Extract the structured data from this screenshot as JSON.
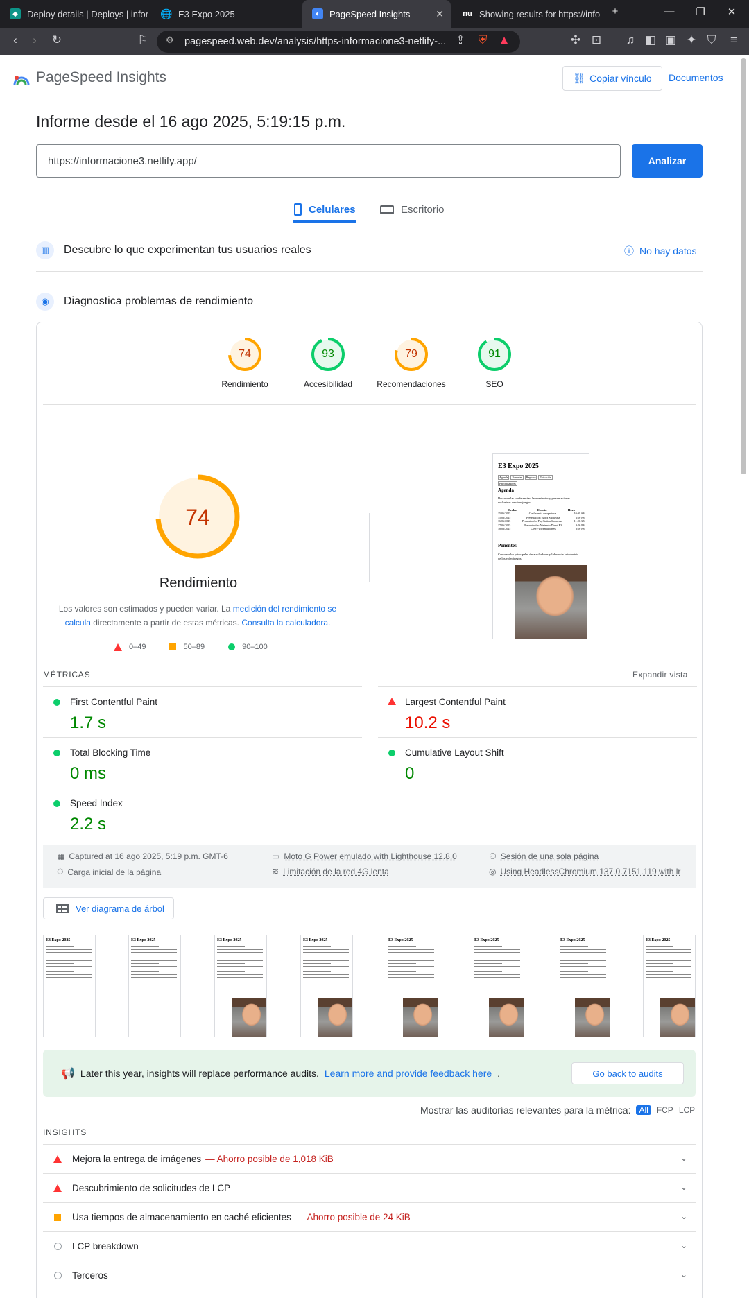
{
  "browser": {
    "tabs": [
      {
        "title": "Deploy details | Deploys | inform",
        "icon": "netlify-icon"
      },
      {
        "title": "E3 Expo 2025",
        "icon": "globe-icon"
      },
      {
        "title": "PageSpeed Insights",
        "icon": "pagespeed-icon"
      },
      {
        "title": "Showing results for https://infor",
        "icon": "search-icon"
      }
    ],
    "url": "pagespeed.web.dev/analysis/https-informacione3-netlify-...",
    "badge_count": "2"
  },
  "header": {
    "brand": "PageSpeed Insights",
    "copy_link": "Copiar vínculo",
    "docs": "Documentos"
  },
  "report": {
    "title": "Informe desde el 16 ago 2025, 5:19:15 p.m.",
    "url_value": "https://informacione3.netlify.app/",
    "analyze": "Analizar",
    "device_tabs": {
      "mobile": "Celulares",
      "desktop": "Escritorio"
    },
    "real_users": {
      "title": "Descubre lo que experimentan tus usuarios reales",
      "status": "No hay datos"
    },
    "diagnose": {
      "title": "Diagnostica problemas de rendimiento"
    }
  },
  "scores": [
    {
      "label": "Rendimiento",
      "value": 74,
      "color": "#ffa400"
    },
    {
      "label": "Accesibilidad",
      "value": 93,
      "color": "#0cce6b"
    },
    {
      "label": "Recomendaciones",
      "value": 79,
      "color": "#ffa400"
    },
    {
      "label": "SEO",
      "value": 91,
      "color": "#0cce6b"
    }
  ],
  "performance": {
    "score": 74,
    "label": "Rendimiento",
    "disclaimer_pre": "Los valores son estimados y pueden variar. La ",
    "disclaimer_link1": "medición del rendimiento se calcula",
    "disclaimer_mid": " directamente a partir de estas métricas. ",
    "disclaimer_link2": "Consulta la calculadora.",
    "legend": [
      "0–49",
      "50–89",
      "90–100"
    ]
  },
  "screenshot": {
    "title": "E3 Expo 2025",
    "nav": [
      "Agenda",
      "Ponentes",
      "Registro",
      "Ubicación",
      "Patrocinadores"
    ],
    "agenda_h": "Agenda",
    "agenda_p": "Descubre las conferencias, lanzamientos y presentaciones exclusivas de videojuegos.",
    "table_head": [
      "Fecha",
      "Evento",
      "Hora"
    ],
    "rows": [
      [
        "15/06/2025",
        "Conferencia de apertura",
        "10:00 AM"
      ],
      [
        "15/06/2025",
        "Presentación: Xbox Showcase",
        "1:00 PM"
      ],
      [
        "16/06/2025",
        "Presentación: PlayStation Showcase",
        "11:00 AM"
      ],
      [
        "17/06/2025",
        "Presentación: Nintendo Direct E3",
        "3:00 PM"
      ],
      [
        "18/06/2025",
        "Cierre y premiaciones",
        "6:00 PM"
      ]
    ],
    "speakers_h": "Ponentes",
    "speakers_p": "Conoce a los principales desarrolladores y líderes de la industria de los videojuegos."
  },
  "metrics": {
    "heading": "MÉTRICAS",
    "expand": "Expandir vista",
    "items": [
      {
        "name": "First Contentful Paint",
        "value": "1.7 s",
        "status": "good"
      },
      {
        "name": "Largest Contentful Paint",
        "value": "10.2 s",
        "status": "poor"
      },
      {
        "name": "Total Blocking Time",
        "value": "0 ms",
        "status": "good"
      },
      {
        "name": "Cumulative Layout Shift",
        "value": "0",
        "status": "good"
      },
      {
        "name": "Speed Index",
        "value": "2.2 s",
        "status": "good"
      }
    ]
  },
  "environment": {
    "captured": "Captured at 16 ago 2025, 5:19 p.m. GMT-6",
    "load": "Carga inicial de la página",
    "device": "Moto G Power emulado with Lighthouse 12.8.0",
    "network": "Limitación de la red 4G lenta",
    "session": "Sesión de una sola página",
    "browser": "Using HeadlessChromium 137.0.7151.119 with lr"
  },
  "tree_button": "Ver diagrama de árbol",
  "banner": {
    "text": "Later this year, insights will replace performance audits.",
    "link": "Learn more and provide feedback here",
    "button": "Go back to audits"
  },
  "audit_filter": {
    "label": "Mostrar las auditorías relevantes para la métrica:",
    "options": [
      "All",
      "FCP",
      "LCP"
    ]
  },
  "insights": {
    "heading": "INSIGHTS",
    "items": [
      {
        "title": "Mejora la entrega de imágenes",
        "saving": "— Ahorro posible de 1,018 KiB",
        "status": "poor"
      },
      {
        "title": "Descubrimiento de solicitudes de LCP",
        "saving": "",
        "status": "poor"
      },
      {
        "title": "Usa tiempos de almacenamiento en caché eficientes",
        "saving": "— Ahorro posible de 24 KiB",
        "status": "average"
      },
      {
        "title": "LCP breakdown",
        "saving": "",
        "status": "info"
      },
      {
        "title": "Terceros",
        "saving": "",
        "status": "info"
      }
    ]
  }
}
